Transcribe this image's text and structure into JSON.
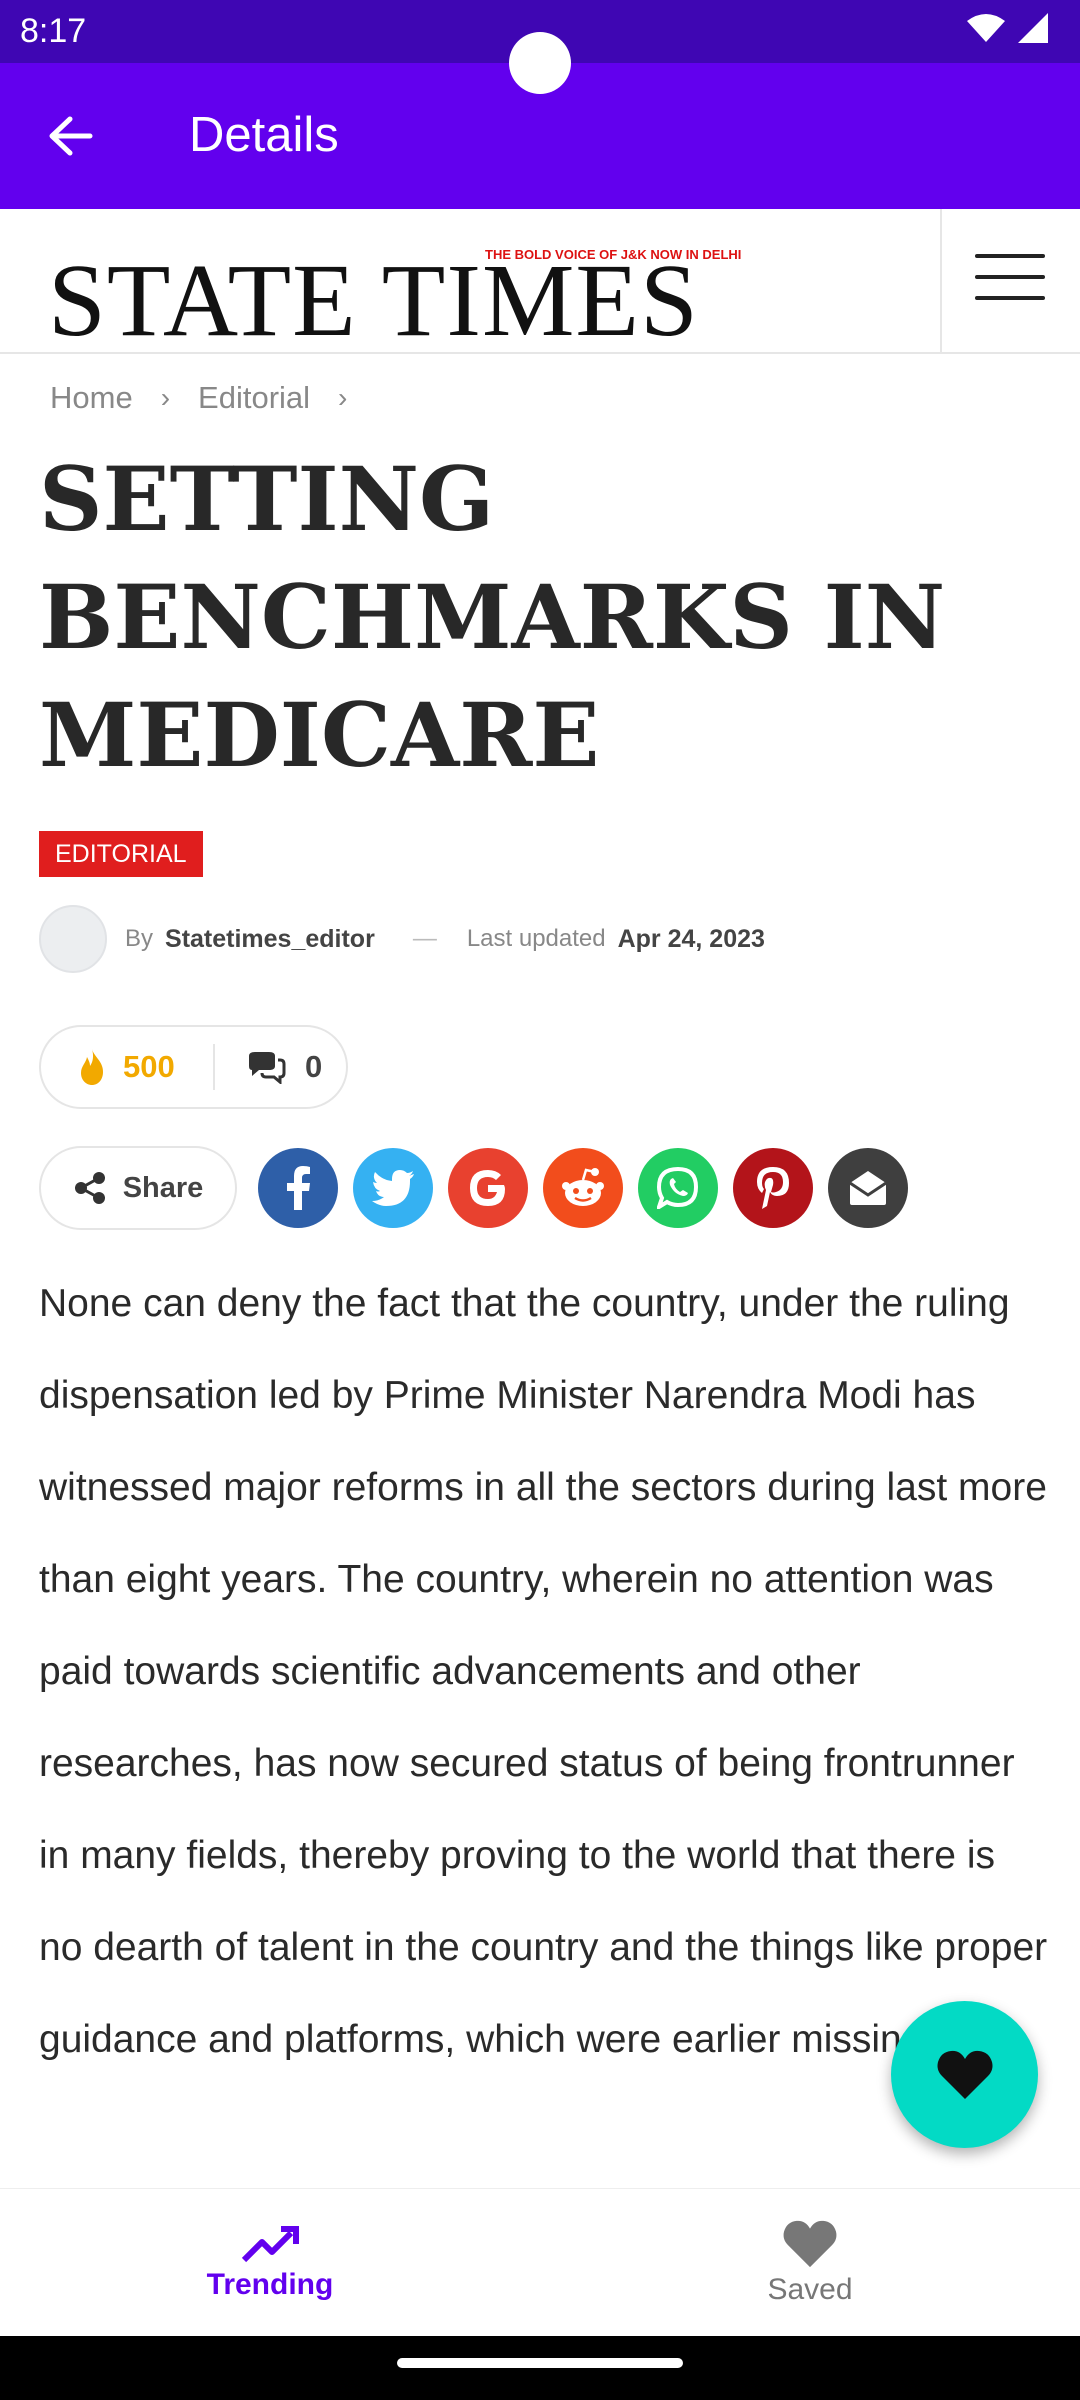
{
  "status_bar": {
    "time": "8:17"
  },
  "app_bar": {
    "title": "Details"
  },
  "site": {
    "logo_text": "STATE TIMES",
    "logo_tagline": "THE BOLD VOICE OF J&K NOW IN DELHI"
  },
  "breadcrumb": {
    "home": "Home",
    "section": "Editorial"
  },
  "article": {
    "title": "SETTING BENCHMARKS IN MEDICARE",
    "category": "EDITORIAL",
    "by_label": "By",
    "author": "Statetimes_editor",
    "dash": "—",
    "updated_label": "Last updated",
    "updated_date": "Apr 24, 2023",
    "views": "500",
    "comments": "0",
    "share_label": "Share",
    "body": "None can deny the fact that the country, under the ruling dispensation led by Prime Minister Narendra Modi has witnessed major reforms in all the sectors during last more than eight years. The country, wherein no attention was paid towards scientific advancements and other researches, has now secured status of being frontrunner in many fields, thereby proving to the world that there is no dearth of talent in the country and the things like proper guidance and platforms, which were earlier missing,"
  },
  "social_icons": [
    {
      "name": "facebook-icon",
      "color": "#2e5fa8",
      "glyph": "f"
    },
    {
      "name": "twitter-icon",
      "color": "#35b1f2",
      "glyph": "t"
    },
    {
      "name": "google-icon",
      "color": "#e8412f",
      "glyph": "G"
    },
    {
      "name": "reddit-icon",
      "color": "#f24d1c",
      "glyph": "r"
    },
    {
      "name": "whatsapp-icon",
      "color": "#22cd63",
      "glyph": "w"
    },
    {
      "name": "pinterest-icon",
      "color": "#b3141a",
      "glyph": "p"
    },
    {
      "name": "email-icon",
      "color": "#3f3f3f",
      "glyph": "e"
    }
  ],
  "bottom_nav": {
    "trending": "Trending",
    "saved": "Saved"
  },
  "colors": {
    "app_bar": "#6200ee",
    "status_bar": "#3f06b3",
    "fab": "#03dac5",
    "badge": "#e01e1e"
  }
}
